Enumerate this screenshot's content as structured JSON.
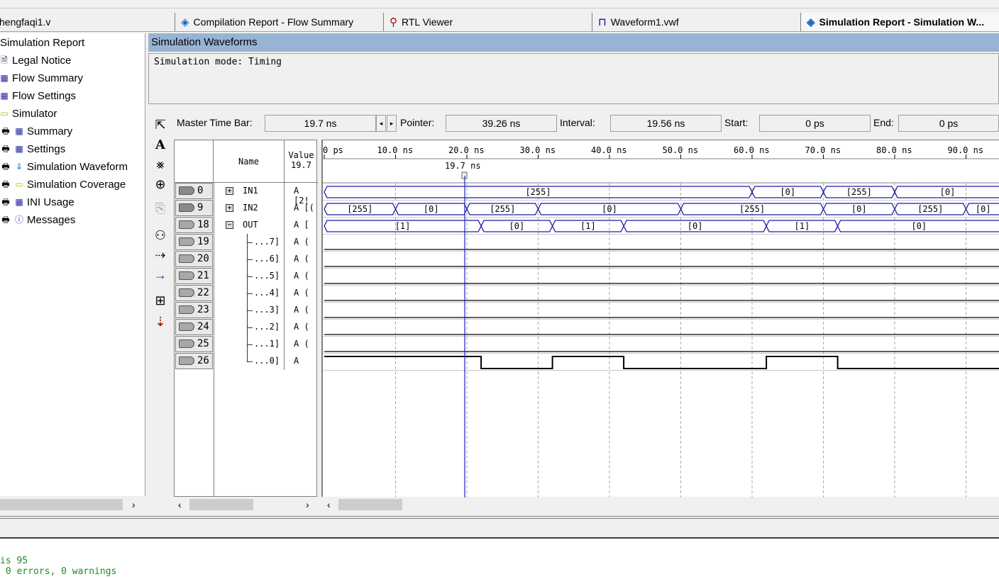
{
  "tabs": [
    {
      "label": "hengfaqi1.v",
      "icon": "verilog-file-icon"
    },
    {
      "label": "Compilation Report - Flow Summary",
      "icon": "report-icon"
    },
    {
      "label": "RTL Viewer",
      "icon": "rtl-viewer-icon"
    },
    {
      "label": "Waveform1.vwf",
      "icon": "waveform-file-icon"
    },
    {
      "label": "Simulation Report - Simulation W...",
      "icon": "report-icon",
      "active": true
    }
  ],
  "tree": {
    "root": "Simulation Report",
    "items": [
      {
        "label": "Legal Notice",
        "icon": "document-icon"
      },
      {
        "label": "Flow Summary",
        "icon": "table-icon"
      },
      {
        "label": "Flow Settings",
        "icon": "table-icon"
      },
      {
        "label": "Simulator",
        "icon": "folder-icon"
      },
      {
        "label": "Summary",
        "icon": "table-icon",
        "child": true
      },
      {
        "label": "Settings",
        "icon": "table-icon",
        "child": true
      },
      {
        "label": "Simulation Waveform",
        "icon": "waveform-icon",
        "child": true
      },
      {
        "label": "Simulation Coverage",
        "icon": "folder-icon",
        "child": true
      },
      {
        "label": "INI Usage",
        "icon": "table-icon",
        "child": true
      },
      {
        "label": "Messages",
        "icon": "info-icon",
        "child": true
      }
    ]
  },
  "report": {
    "header": "Simulation Waveforms",
    "mode": "Simulation mode: Timing"
  },
  "timebar": {
    "master_label": "Master Time Bar:",
    "master_value": "19.7 ns",
    "pointer_label": "Pointer:",
    "pointer_value": "39.26 ns",
    "interval_label": "Interval:",
    "interval_value": "19.56 ns",
    "start_label": "Start:",
    "start_value": "0 ps",
    "end_label": "End:",
    "end_value": "0 ps"
  },
  "columns": {
    "name": "Name",
    "value": "Value",
    "value_time": "19.7"
  },
  "time_axis": {
    "ticks": [
      "0 ps",
      "10.0 ns",
      "20.0 ns",
      "30.0 ns",
      "40.0 ns",
      "50.0 ns",
      "60.0 ns",
      "70.0 ns",
      "80.0 ns",
      "90.0 ns"
    ],
    "unit_ns_per_tick": 10,
    "cursor_ns": 19.7,
    "cursor_label": "19.7 ns"
  },
  "signals": [
    {
      "index": "0",
      "name": "IN1",
      "value": "A [2!",
      "type": "bus",
      "expand": "+",
      "direction": "input",
      "segments": [
        [
          0,
          60,
          "[255]"
        ],
        [
          60,
          70,
          "[0]"
        ],
        [
          70,
          80,
          "[255]"
        ],
        [
          80,
          100,
          "[0]"
        ]
      ]
    },
    {
      "index": "9",
      "name": "IN2",
      "value": "A [(",
      "type": "bus",
      "expand": "+",
      "direction": "input",
      "segments": [
        [
          0,
          10,
          "[255]"
        ],
        [
          10,
          20,
          "[0]"
        ],
        [
          20,
          30,
          "[255]"
        ],
        [
          30,
          50,
          "[0]"
        ],
        [
          50,
          70,
          "[255]"
        ],
        [
          70,
          80,
          "[0]"
        ],
        [
          80,
          90,
          "[255]"
        ],
        [
          90,
          100,
          "[0]"
        ]
      ]
    },
    {
      "index": "18",
      "name": "OUT",
      "value": "A [",
      "type": "bus",
      "expand": "−",
      "direction": "output",
      "segments": [
        [
          0,
          22,
          "[1]"
        ],
        [
          22,
          32,
          "[0]"
        ],
        [
          32,
          42,
          "[1]"
        ],
        [
          42,
          62,
          "[0]"
        ],
        [
          62,
          72,
          "[1]"
        ],
        [
          72,
          100,
          "[0]"
        ]
      ]
    },
    {
      "index": "19",
      "name": "...7]",
      "value": "A (",
      "type": "bit",
      "direction": "output",
      "levels": [
        [
          0,
          100,
          0
        ]
      ]
    },
    {
      "index": "20",
      "name": "...6]",
      "value": "A (",
      "type": "bit",
      "direction": "output",
      "levels": [
        [
          0,
          100,
          0
        ]
      ]
    },
    {
      "index": "21",
      "name": "...5]",
      "value": "A (",
      "type": "bit",
      "direction": "output",
      "levels": [
        [
          0,
          100,
          0
        ]
      ]
    },
    {
      "index": "22",
      "name": "...4]",
      "value": "A (",
      "type": "bit",
      "direction": "output",
      "levels": [
        [
          0,
          100,
          0
        ]
      ]
    },
    {
      "index": "23",
      "name": "...3]",
      "value": "A (",
      "type": "bit",
      "direction": "output",
      "levels": [
        [
          0,
          100,
          0
        ]
      ]
    },
    {
      "index": "24",
      "name": "...2]",
      "value": "A (",
      "type": "bit",
      "direction": "output",
      "levels": [
        [
          0,
          100,
          0
        ]
      ]
    },
    {
      "index": "25",
      "name": "...1]",
      "value": "A (",
      "type": "bit",
      "direction": "output",
      "levels": [
        [
          0,
          100,
          0
        ]
      ]
    },
    {
      "index": "26",
      "name": "...0]",
      "value": "A",
      "type": "bit",
      "direction": "output",
      "levels": [
        [
          0,
          22,
          1
        ],
        [
          22,
          32,
          0
        ],
        [
          32,
          42,
          1
        ],
        [
          42,
          62,
          0
        ],
        [
          62,
          72,
          1
        ],
        [
          72,
          100,
          0
        ]
      ]
    }
  ],
  "messages": [
    "is 95",
    " 0 errors, 0 warnings"
  ],
  "colors": {
    "bus": "#1c1ca8",
    "cursor": "#2020c0",
    "header": "#98b4d4",
    "message": "#228b22"
  }
}
